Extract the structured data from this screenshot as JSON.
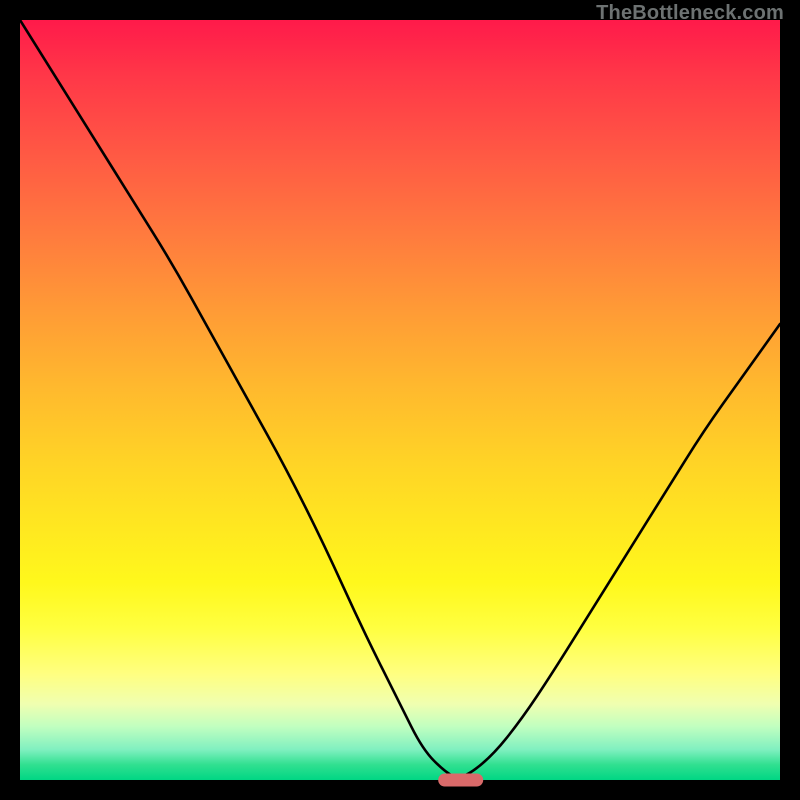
{
  "watermark": {
    "text": "TheBottleneck.com"
  },
  "chart_data": {
    "type": "line",
    "title": "",
    "xlabel": "",
    "ylabel": "",
    "xlim": [
      0,
      100
    ],
    "ylim": [
      0,
      100
    ],
    "series": [
      {
        "name": "bottleneck-curve",
        "x": [
          0,
          5,
          10,
          15,
          20,
          25,
          30,
          35,
          40,
          45,
          50,
          53,
          56,
          58,
          62,
          66,
          70,
          75,
          80,
          85,
          90,
          95,
          100
        ],
        "values": [
          100,
          92,
          84,
          76,
          68,
          59,
          50,
          41,
          31,
          20,
          10,
          4,
          1,
          0,
          3,
          8,
          14,
          22,
          30,
          38,
          46,
          53,
          60
        ]
      }
    ],
    "marker": {
      "x": 58,
      "y": 0,
      "width_pct": 6
    },
    "background_gradient": [
      {
        "stop": 0,
        "color": "#ff1a4a"
      },
      {
        "stop": 50,
        "color": "#ffd326"
      },
      {
        "stop": 85,
        "color": "#ffff80"
      },
      {
        "stop": 100,
        "color": "#00d684"
      }
    ]
  }
}
